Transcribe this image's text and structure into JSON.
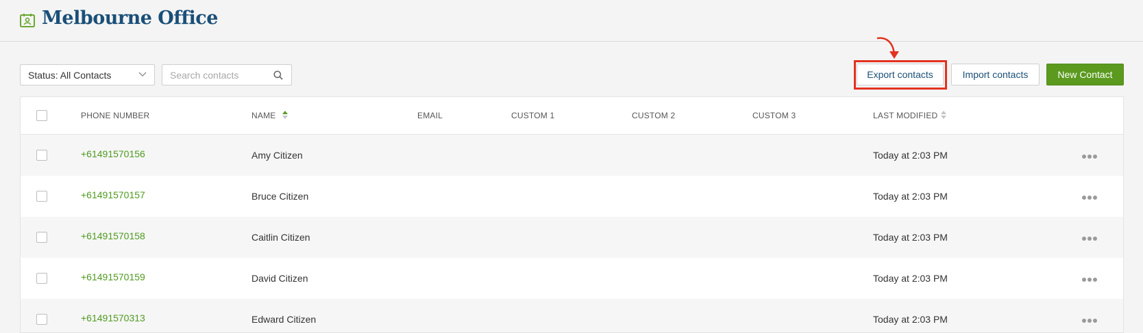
{
  "header": {
    "title": "Melbourne Office",
    "icon": "contact-book-icon"
  },
  "toolbar": {
    "status_label": "Status: All Contacts",
    "search_placeholder": "Search contacts",
    "export_label": "Export contacts",
    "import_label": "Import contacts",
    "new_label": "New Contact"
  },
  "table": {
    "columns": {
      "phone": "PHONE NUMBER",
      "name": "NAME",
      "email": "EMAIL",
      "custom1": "CUSTOM 1",
      "custom2": "CUSTOM 2",
      "custom3": "CUSTOM 3",
      "modified": "LAST MODIFIED"
    },
    "rows": [
      {
        "phone": "+61491570156",
        "name": "Amy Citizen",
        "modified": "Today at 2:03 PM"
      },
      {
        "phone": "+61491570157",
        "name": "Bruce Citizen",
        "modified": "Today at 2:03 PM"
      },
      {
        "phone": "+61491570158",
        "name": "Caitlin Citizen",
        "modified": "Today at 2:03 PM"
      },
      {
        "phone": "+61491570159",
        "name": "David Citizen",
        "modified": "Today at 2:03 PM"
      },
      {
        "phone": "+61491570313",
        "name": "Edward Citizen",
        "modified": "Today at 2:03 PM"
      }
    ]
  },
  "colors": {
    "brand_blue": "#1a4f78",
    "accent_green": "#5b9a1f",
    "phone_green": "#4e9a1e",
    "highlight_red": "#e3311f"
  }
}
